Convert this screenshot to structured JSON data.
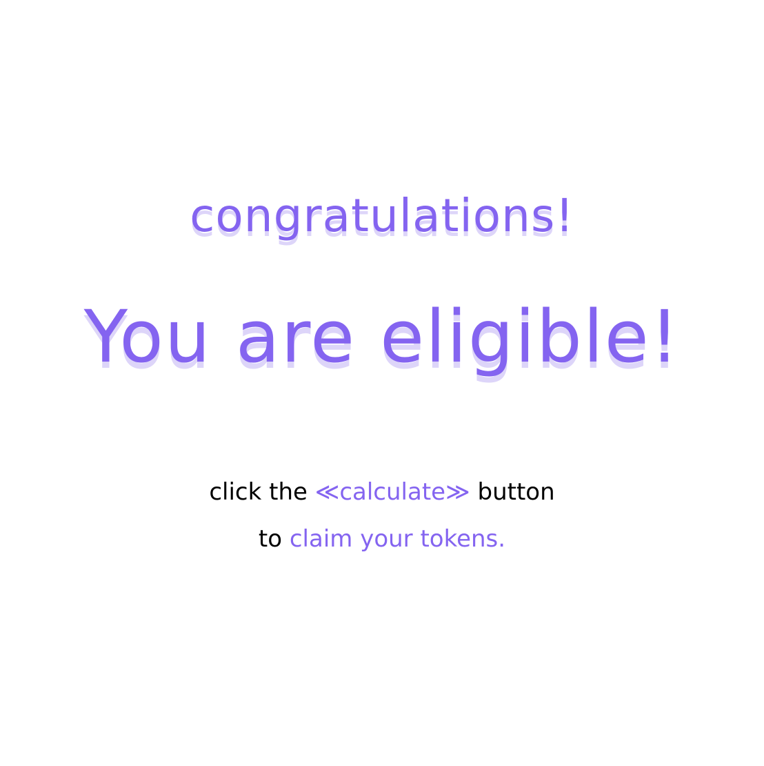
{
  "congrats_text": "congratulations!",
  "eligible_text": "You are eligible!",
  "instruction": {
    "prefix": "click the",
    "left_chevron": "≪",
    "button_label": "calculate",
    "right_chevron": "≫",
    "suffix": "button",
    "line2_prefix": "to",
    "line2_highlight": "claim your tokens."
  },
  "colors": {
    "accent": "#8464f0",
    "shadow": "#ddd5f9",
    "text": "#000000",
    "background": "#ffffff"
  }
}
